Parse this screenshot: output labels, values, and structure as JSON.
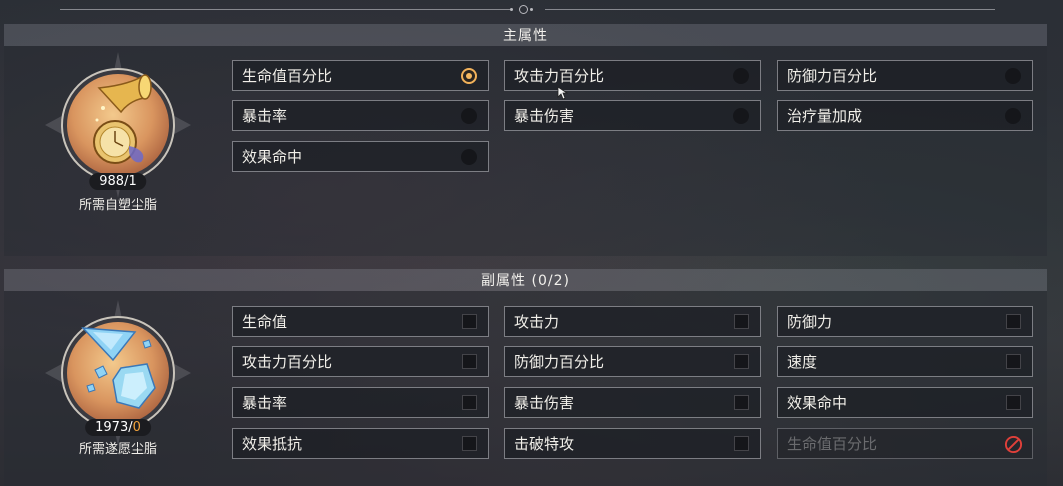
{
  "main_stat": {
    "title": "主属性",
    "options": [
      {
        "label": "生命值百分比",
        "selected": true
      },
      {
        "label": "攻击力百分比",
        "selected": false
      },
      {
        "label": "防御力百分比",
        "selected": false
      },
      {
        "label": "暴击率",
        "selected": false
      },
      {
        "label": "暴击伤害",
        "selected": false
      },
      {
        "label": "治疗量加成",
        "selected": false
      },
      {
        "label": "效果命中",
        "selected": false
      }
    ],
    "resource": {
      "count": "988/1",
      "caption": "所需自塑尘脂",
      "icon": "self-modeling-resin-icon"
    }
  },
  "sub_stat": {
    "title": "副属性 (0/2)",
    "options": [
      {
        "label": "生命值",
        "checked": false
      },
      {
        "label": "攻击力",
        "checked": false
      },
      {
        "label": "防御力",
        "checked": false
      },
      {
        "label": "攻击力百分比",
        "checked": false
      },
      {
        "label": "防御力百分比",
        "checked": false
      },
      {
        "label": "速度",
        "checked": false
      },
      {
        "label": "暴击率",
        "checked": false
      },
      {
        "label": "暴击伤害",
        "checked": false
      },
      {
        "label": "效果命中",
        "checked": false
      },
      {
        "label": "效果抵抗",
        "checked": false
      },
      {
        "label": "击破特攻",
        "checked": false
      },
      {
        "label": "生命值百分比",
        "checked": false,
        "disabled": true
      }
    ],
    "resource": {
      "count_main": "1973/",
      "count_zero": "0",
      "caption": "所需遂愿尘脂",
      "icon": "wish-fulfilling-resin-icon"
    }
  },
  "colors": {
    "accent": "#f2b25a",
    "forbidden": "#e0403a",
    "zero_count": "#f2a23b"
  }
}
